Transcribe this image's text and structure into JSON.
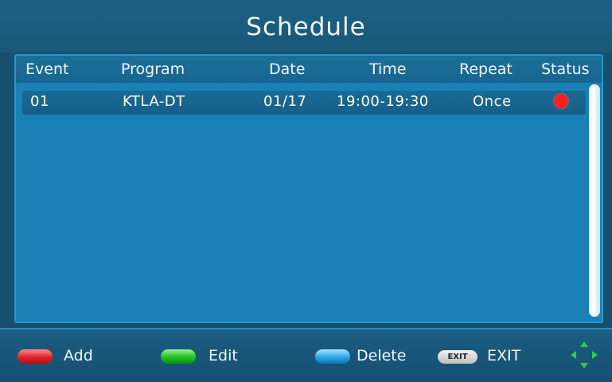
{
  "title": "Schedule",
  "table": {
    "columns": [
      "Event",
      "Program",
      "Date",
      "Time",
      "Repeat",
      "Status"
    ],
    "rows": [
      {
        "event": "01",
        "program": "KTLA-DT",
        "date": "01/17",
        "time": "19:00-19:30",
        "repeat": "Once",
        "status": "recording-scheduled"
      }
    ]
  },
  "footer": {
    "add_label": "Add",
    "edit_label": "Edit",
    "delete_label": "Delete",
    "exit_key_label": "EXIT",
    "exit_label": "EXIT"
  },
  "colors": {
    "add_key": "#e0242a",
    "edit_key": "#1fc221",
    "delete_key": "#2aa6e6",
    "status_dot": "#ff1f1f"
  },
  "icons": {
    "status": "red-dot-icon",
    "navigation": "dpad-arrows-icon"
  }
}
